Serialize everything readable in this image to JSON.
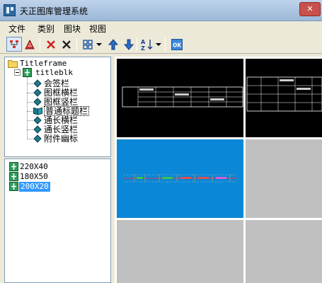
{
  "window": {
    "title": "天正图库管理系统",
    "close_glyph": "✕"
  },
  "menu": [
    "文件",
    "类别",
    "图块",
    "视图"
  ],
  "toolbar": [
    {
      "icon": "tree-view-icon"
    },
    {
      "icon": "pyramid-icon"
    },
    {
      "icon": "delete-icon"
    },
    {
      "icon": "cancel-icon"
    },
    {
      "icon": "layout-icon"
    },
    {
      "icon": "move-up-icon"
    },
    {
      "icon": "move-down-icon"
    },
    {
      "icon": "sort-icon"
    },
    {
      "icon": "ok-icon"
    }
  ],
  "toolbar_labels": {
    "sort_top": "A",
    "sort_bottom": "Z",
    "ok": "OK"
  },
  "tree": {
    "root": "Titleframe",
    "child": "titleblk",
    "items": [
      "会签栏",
      "图框横栏",
      "图框竖栏",
      "普通标题栏",
      "通长横栏",
      "通长竖栏",
      "附件幽标"
    ],
    "selected_index": 3
  },
  "sizes": {
    "items": [
      "220X40",
      "180X50",
      "200X20"
    ],
    "selected_index": 2
  },
  "thumbnails": {
    "colors": {
      "dark": "#000000",
      "blue": "#0a87d6",
      "empty": "#c0c0c0",
      "line": "#ffffff"
    }
  },
  "colors": {
    "selection": "#3399ff",
    "window_bg": "#ece9d8",
    "title_bar": "#a9c2df"
  }
}
